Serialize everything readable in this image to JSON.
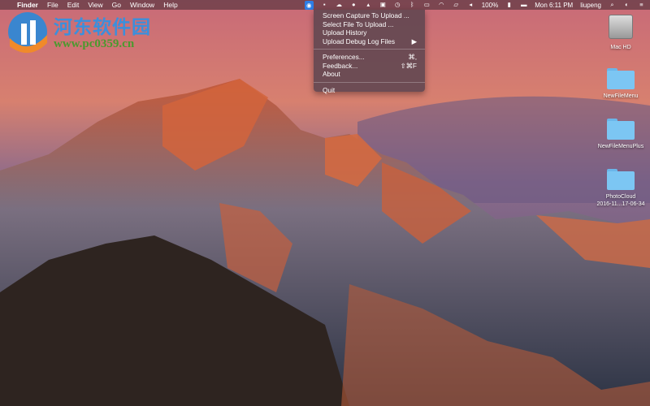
{
  "menubar": {
    "apple": "",
    "app": "Finder",
    "items": [
      "File",
      "Edit",
      "View",
      "Go",
      "Window",
      "Help"
    ],
    "status": {
      "battery": "100%",
      "clock": "Mon 6:11 PM",
      "user": "liupeng"
    }
  },
  "dropdown": {
    "items": [
      {
        "label": "Screen Capture To Upload ...",
        "shortcut": ""
      },
      {
        "label": "Select File To Upload ...",
        "shortcut": ""
      },
      {
        "label": "Upload History",
        "shortcut": ""
      },
      {
        "label": "Upload Debug Log Files",
        "shortcut": "▶"
      },
      {
        "label": "Preferences...",
        "shortcut": "⌘,"
      },
      {
        "label": "Feedback...",
        "shortcut": "⇧⌘F"
      },
      {
        "label": "About",
        "shortcut": ""
      },
      {
        "label": "Quit",
        "shortcut": ""
      }
    ]
  },
  "watermark": {
    "name": "河东软件园",
    "url": "www.pc0359.cn"
  },
  "desktop": {
    "icons": [
      {
        "label": "Mac HD"
      },
      {
        "label": "NewFileMenu"
      },
      {
        "label": "NewFileMenuPlus"
      },
      {
        "label": "PhotoCloud",
        "sub": "2016-11...17-06-34"
      }
    ]
  }
}
